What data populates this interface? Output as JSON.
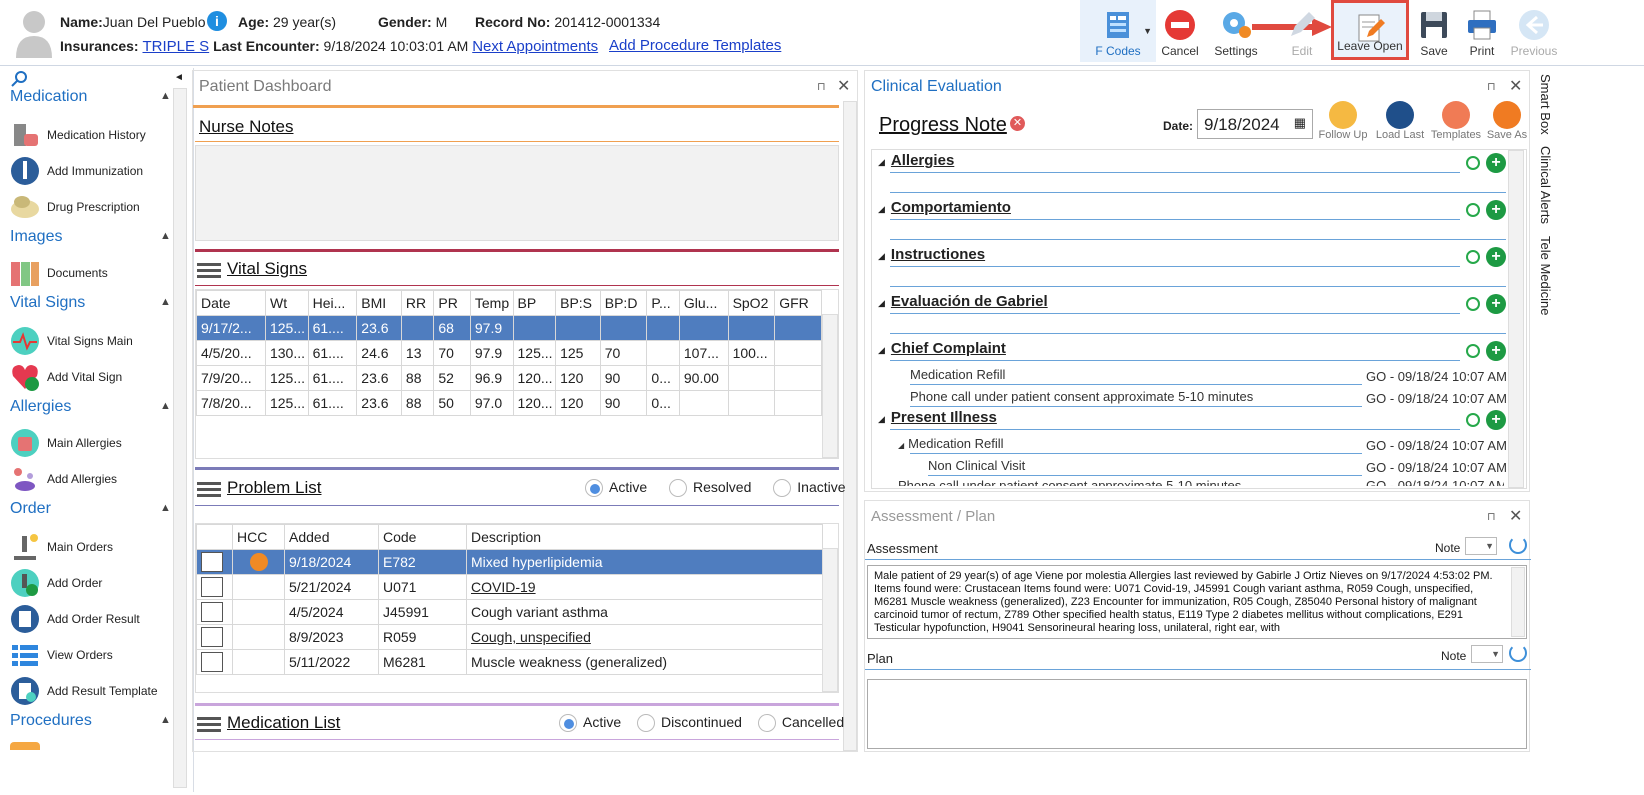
{
  "header": {
    "name_label": "Name:",
    "name": "Juan Del Pueblo",
    "age_label": "Age:",
    "age": "29 year(s)",
    "gender_label": "Gender:",
    "gender": "M",
    "record_label": "Record No:",
    "record": "201412-0001334",
    "ins_label": "Insurances:",
    "insurance": "TRIPLE S",
    "last_label": "Last Encounter:",
    "last_encounter": "9/18/2024 10:03:01 AM",
    "next_appt": "Next Appointments",
    "add_proc": "Add Procedure Templates"
  },
  "toolbar": {
    "fcodes": "F Codes",
    "cancel": "Cancel",
    "settings": "Settings",
    "edit": "Edit",
    "leave_open": "Leave Open",
    "save": "Save",
    "print": "Print",
    "previous": "Previous"
  },
  "sidebar": {
    "medication": "Medication",
    "medication_history": "Medication History",
    "add_immunization": "Add Immunization",
    "drug_prescription": "Drug Prescription",
    "images": "Images",
    "documents": "Documents",
    "vital_signs": "Vital Signs",
    "vital_signs_main": "Vital Signs Main",
    "add_vital_sign": "Add Vital Sign",
    "allergies": "Allergies",
    "main_allergies": "Main Allergies",
    "add_allergies": "Add Allergies",
    "order": "Order",
    "main_orders": "Main Orders",
    "add_order": "Add Order",
    "add_order_result": "Add Order Result",
    "view_orders": "View Orders",
    "add_result_template": "Add Result Template",
    "procedures": "Procedures"
  },
  "dashboard": {
    "title": "Patient Dashboard",
    "nurse_notes": "Nurse Notes",
    "vital_signs": "Vital Signs",
    "vital_headers": [
      "Date",
      "Wt",
      "Hei...",
      "BMI",
      "RR",
      "PR",
      "Temp",
      "BP",
      "BP:S",
      "BP:D",
      "P...",
      "Glu...",
      "SpO2",
      "GFR"
    ],
    "vital_rows": [
      [
        "9/17/2...",
        "125...",
        "61....",
        "23.6",
        "",
        "68",
        "97.9",
        "",
        "",
        "",
        "",
        "",
        "",
        ""
      ],
      [
        "4/5/20...",
        "130...",
        "61....",
        "24.6",
        "13",
        "70",
        "97.9",
        "125...",
        "125",
        "70",
        "",
        "107...",
        "100...",
        ""
      ],
      [
        "7/9/20...",
        "125...",
        "61....",
        "23.6",
        "88",
        "52",
        "96.9",
        "120...",
        "120",
        "90",
        "0...",
        "90.00",
        "",
        ""
      ],
      [
        "7/8/20...",
        "125...",
        "61....",
        "23.6",
        "88",
        "50",
        "97.0",
        "120...",
        "120",
        "90",
        "0...",
        "",
        "",
        ""
      ]
    ],
    "problem_list": "Problem List",
    "pl_active": "Active",
    "pl_resolved": "Resolved",
    "pl_inactive": "Inactive",
    "problem_headers": [
      "",
      "HCC",
      "Added",
      "Code",
      "Description"
    ],
    "problem_rows": [
      {
        "added": "9/18/2024",
        "code": "E782",
        "desc": "Mixed hyperlipidemia"
      },
      {
        "added": "5/21/2024",
        "code": "U071",
        "desc": "COVID-19"
      },
      {
        "added": "4/5/2024",
        "code": "J45991",
        "desc": "Cough variant asthma"
      },
      {
        "added": "8/9/2023",
        "code": "R059",
        "desc": "Cough, unspecified"
      },
      {
        "added": "5/11/2022",
        "code": "M6281",
        "desc": "Muscle weakness (generalized)"
      }
    ],
    "medication_list": "Medication List",
    "ml_active": "Active",
    "ml_discontinued": "Discontinued",
    "ml_cancelled": "Cancelled"
  },
  "clinical": {
    "title": "Clinical Evaluation",
    "progress_note": "Progress Note",
    "date_label": "Date:",
    "date": "9/18/2024",
    "follow_up": "Follow Up",
    "load_last": "Load Last",
    "templates": "Templates",
    "save_as": "Save As",
    "sections": [
      "Allergies",
      "Comportamiento",
      "Instructiones",
      "Evaluación de Gabriel",
      "Chief Complaint",
      "Present Illness"
    ],
    "cc1": "Medication Refill",
    "cc2": "Phone call under patient consent approximate 5-10 minutes",
    "stamp": "GO - 09/18/24 10:07 AM",
    "pi1": "Medication Refill",
    "pi2": "Non Clinical Visit",
    "pi3": "Phone call under patient consent approximate 5-10 minutes"
  },
  "assessment": {
    "title": "Assessment / Plan",
    "assessment_label": "Assessment",
    "note": "Note",
    "plan_label": "Plan",
    "text": "Male patient of 29 year(s) of age Viene por molestia     Allergies last reviewed by Gabirle J Ortiz Nieves on 9/17/2024 4:53:02 PM.    Items found were:  Crustacean  Items found were:  U071 Covid-19, J45991 Cough variant asthma, R059 Cough, unspecified, M6281 Muscle weakness (generalized), Z23 Encounter for immunization, R05 Cough, Z85040 Personal history of malignant carcinoid tumor of rectum, Z789 Other specified health status, E119 Type 2 diabetes mellitus without complications, E291 Testicular hypofunction, H9041 Sensorineural hearing loss, unilateral, right ear, with"
  },
  "right_tabs": {
    "smart_box": "Smart Box",
    "clinical_alerts": "Clinical Alerts",
    "tele_medicine": "Tele Medicine"
  },
  "colors": {
    "accent": "#1f6fc2",
    "selected_row": "#4f7dbf",
    "highlight_box": "#e04a3f",
    "plus": "#1d9a43"
  }
}
